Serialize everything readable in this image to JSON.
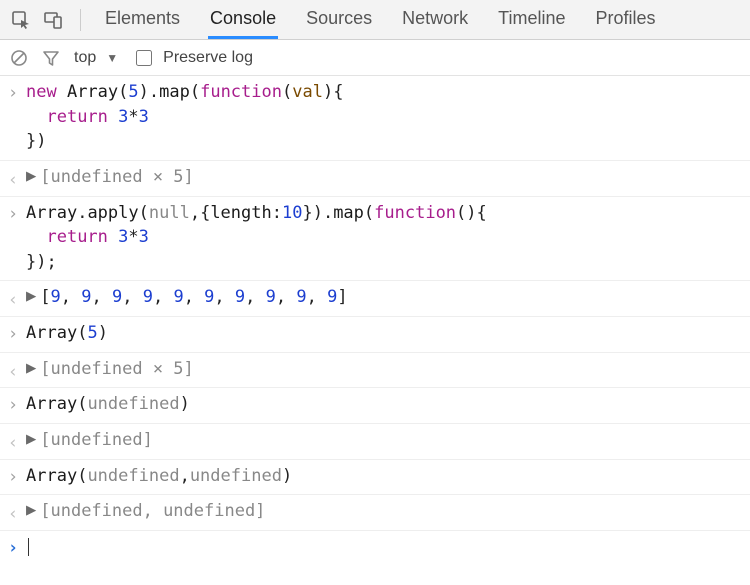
{
  "tabs": {
    "elements": "Elements",
    "console": "Console",
    "sources": "Sources",
    "network": "Network",
    "timeline": "Timeline",
    "profiles": "Profiles"
  },
  "subbar": {
    "context": "top",
    "preserve_label": "Preserve log"
  },
  "entries": [
    {
      "input": {
        "tokens": [
          {
            "t": "new ",
            "c": "kw"
          },
          {
            "t": "Array",
            "c": "obj"
          },
          {
            "t": "(",
            "c": "punc"
          },
          {
            "t": "5",
            "c": "num"
          },
          {
            "t": ").",
            "c": "punc"
          },
          {
            "t": "map",
            "c": "fn"
          },
          {
            "t": "(",
            "c": "punc"
          },
          {
            "t": "function",
            "c": "kw"
          },
          {
            "t": "(",
            "c": "punc"
          },
          {
            "t": "val",
            "c": "param"
          },
          {
            "t": "){",
            "c": "punc"
          },
          {
            "t": "\n  ",
            "c": ""
          },
          {
            "t": "return ",
            "c": "kw"
          },
          {
            "t": "3",
            "c": "num"
          },
          {
            "t": "*",
            "c": "punc"
          },
          {
            "t": "3",
            "c": "num"
          },
          {
            "t": "\n})",
            "c": "punc"
          }
        ]
      },
      "output": {
        "text": "[undefined × 5]"
      }
    },
    {
      "input": {
        "tokens": [
          {
            "t": "Array",
            "c": "obj"
          },
          {
            "t": ".",
            "c": "punc"
          },
          {
            "t": "apply",
            "c": "fn"
          },
          {
            "t": "(",
            "c": "punc"
          },
          {
            "t": "null",
            "c": "null"
          },
          {
            "t": ",{",
            "c": "punc"
          },
          {
            "t": "length",
            "c": "obj"
          },
          {
            "t": ":",
            "c": "punc"
          },
          {
            "t": "10",
            "c": "num"
          },
          {
            "t": "}).",
            "c": "punc"
          },
          {
            "t": "map",
            "c": "fn"
          },
          {
            "t": "(",
            "c": "punc"
          },
          {
            "t": "function",
            "c": "kw"
          },
          {
            "t": "(){",
            "c": "punc"
          },
          {
            "t": "\n  ",
            "c": ""
          },
          {
            "t": "return ",
            "c": "kw"
          },
          {
            "t": "3",
            "c": "num"
          },
          {
            "t": "*",
            "c": "punc"
          },
          {
            "t": "3",
            "c": "num"
          },
          {
            "t": "\n});",
            "c": "punc"
          }
        ]
      },
      "output": {
        "array_nums": [
          "9",
          "9",
          "9",
          "9",
          "9",
          "9",
          "9",
          "9",
          "9",
          "9"
        ]
      }
    },
    {
      "input": {
        "tokens": [
          {
            "t": "Array",
            "c": "obj"
          },
          {
            "t": "(",
            "c": "punc"
          },
          {
            "t": "5",
            "c": "num"
          },
          {
            "t": ")",
            "c": "punc"
          }
        ]
      },
      "output": {
        "text": "[undefined × 5]"
      }
    },
    {
      "input": {
        "tokens": [
          {
            "t": "Array",
            "c": "obj"
          },
          {
            "t": "(",
            "c": "punc"
          },
          {
            "t": "undefined",
            "c": "undef"
          },
          {
            "t": ")",
            "c": "punc"
          }
        ]
      },
      "output": {
        "text": "[undefined]"
      }
    },
    {
      "input": {
        "tokens": [
          {
            "t": "Array",
            "c": "obj"
          },
          {
            "t": "(",
            "c": "punc"
          },
          {
            "t": "undefined",
            "c": "undef"
          },
          {
            "t": ",",
            "c": "punc"
          },
          {
            "t": "undefined",
            "c": "undef"
          },
          {
            "t": ")",
            "c": "punc"
          }
        ]
      },
      "output": {
        "text": "[undefined, undefined]"
      }
    }
  ]
}
